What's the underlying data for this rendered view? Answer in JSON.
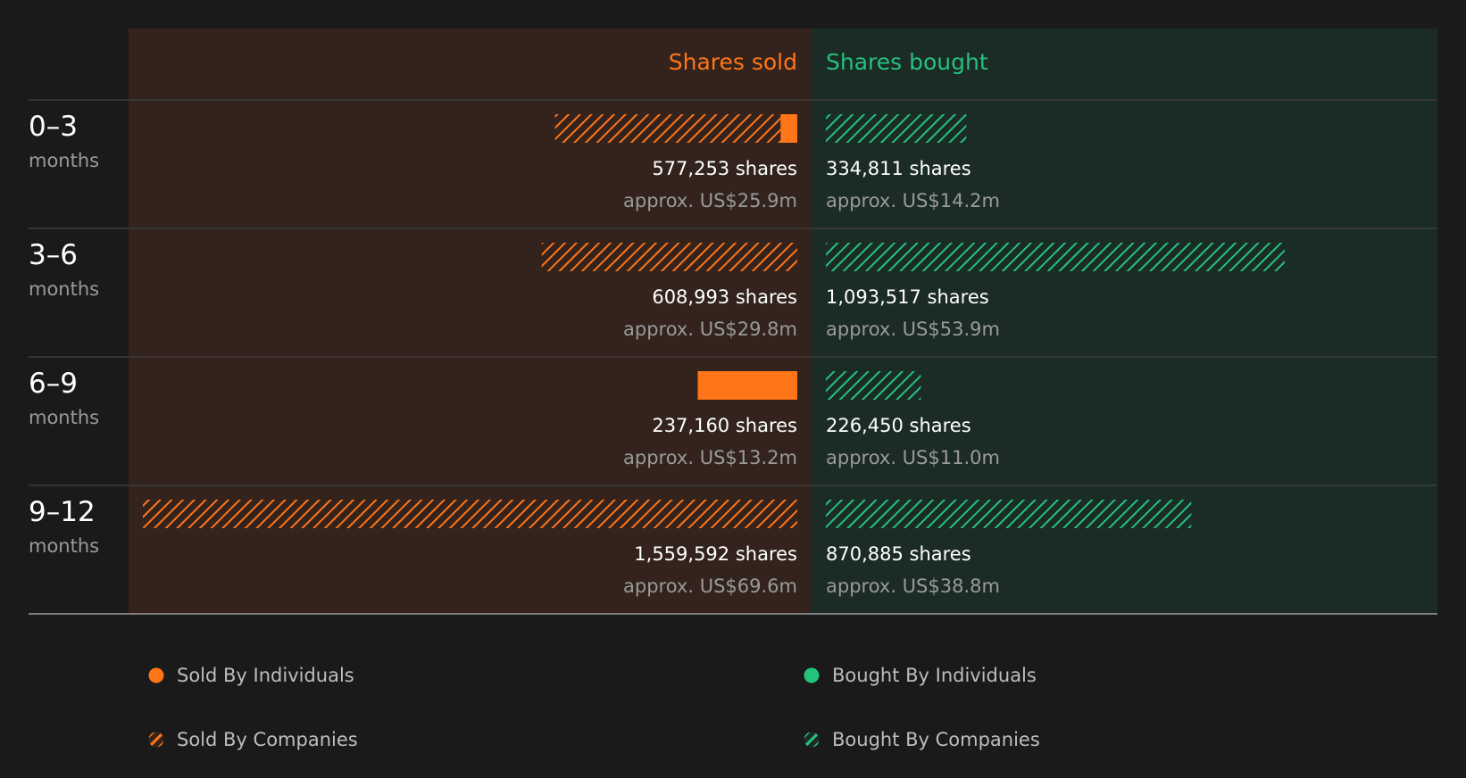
{
  "chart_data": {
    "type": "bar",
    "headers": {
      "sold": "Shares sold",
      "bought": "Shares bought"
    },
    "categories": [
      {
        "range": "0–3",
        "unit": "months"
      },
      {
        "range": "3–6",
        "unit": "months"
      },
      {
        "range": "6–9",
        "unit": "months"
      },
      {
        "range": "9–12",
        "unit": "months"
      }
    ],
    "series": [
      {
        "name": "Sold By Individuals",
        "side": "sold",
        "pattern": "solid",
        "values": [
          40000,
          0,
          237160,
          0
        ]
      },
      {
        "name": "Sold By Companies",
        "side": "sold",
        "pattern": "hatched",
        "values": [
          537253,
          608993,
          0,
          1559592
        ]
      },
      {
        "name": "Bought By Individuals",
        "side": "bought",
        "pattern": "solid",
        "values": [
          0,
          0,
          0,
          0
        ]
      },
      {
        "name": "Bought By Companies",
        "side": "bought",
        "pattern": "hatched",
        "values": [
          334811,
          1093517,
          226450,
          870885
        ]
      }
    ],
    "sold_totals": [
      {
        "shares": "577,253 shares",
        "usd": "approx. US$25.9m"
      },
      {
        "shares": "608,993 shares",
        "usd": "approx. US$29.8m"
      },
      {
        "shares": "237,160 shares",
        "usd": "approx. US$13.2m"
      },
      {
        "shares": "1,559,592 shares",
        "usd": "approx. US$69.6m"
      }
    ],
    "bought_totals": [
      {
        "shares": "334,811 shares",
        "usd": "approx. US$14.2m"
      },
      {
        "shares": "1,093,517 shares",
        "usd": "approx. US$53.9m"
      },
      {
        "shares": "226,450 shares",
        "usd": "approx. US$11.0m"
      },
      {
        "shares": "870,885 shares",
        "usd": "approx. US$38.8m"
      }
    ],
    "max_value": 1559592,
    "colors": {
      "sold": "#ff7518",
      "bought": "#25c27e",
      "sold_bg": "#33231c",
      "bought_bg": "#1b2b25",
      "page_bg": "#1a1a1a"
    },
    "legend_placement": "bottom"
  }
}
